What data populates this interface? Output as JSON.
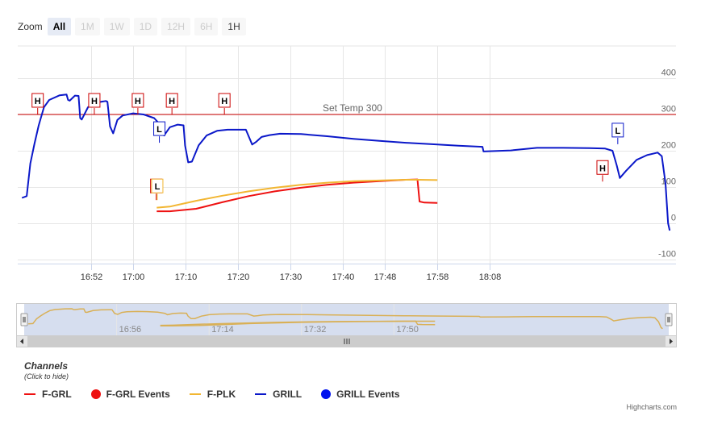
{
  "zoom": {
    "label": "Zoom",
    "buttons": [
      {
        "label": "All",
        "state": "active"
      },
      {
        "label": "1M",
        "state": "disabled"
      },
      {
        "label": "1W",
        "state": "disabled"
      },
      {
        "label": "1D",
        "state": "disabled"
      },
      {
        "label": "12H",
        "state": "disabled"
      },
      {
        "label": "6H",
        "state": "disabled"
      },
      {
        "label": "1H",
        "state": "enabled"
      }
    ]
  },
  "chart_data": {
    "type": "line",
    "x_ticks": [
      "16:52",
      "17:00",
      "17:10",
      "17:20",
      "17:30",
      "17:40",
      "17:48",
      "17:58",
      "18:08"
    ],
    "y_ticks": [
      400,
      300,
      200,
      100,
      0,
      -100
    ],
    "ylim": [
      -100,
      400
    ],
    "grid": true,
    "plot_line": {
      "value": 300,
      "label": "Set Temp 300",
      "color": "#cc0000"
    },
    "series": [
      {
        "name": "F-GRL",
        "color": "#ee1111",
        "points": [
          [
            -9,
            null
          ],
          [
            12.5,
            33
          ],
          [
            15,
            33
          ],
          [
            20,
            40
          ],
          [
            25,
            58
          ],
          [
            30,
            75
          ],
          [
            35,
            88
          ],
          [
            40,
            98
          ],
          [
            45,
            106
          ],
          [
            50,
            112
          ],
          [
            55,
            116
          ],
          [
            60,
            120
          ],
          [
            62.2,
            121
          ],
          [
            62.6,
            60
          ],
          [
            63.5,
            57
          ],
          [
            66,
            56
          ]
        ]
      },
      {
        "name": "F-PLK",
        "color": "#f2b632",
        "points": [
          [
            12.5,
            43
          ],
          [
            15,
            46
          ],
          [
            20,
            62
          ],
          [
            25,
            76
          ],
          [
            30,
            88
          ],
          [
            35,
            98
          ],
          [
            40,
            106
          ],
          [
            45,
            112
          ],
          [
            50,
            116
          ],
          [
            55,
            118
          ],
          [
            60,
            120
          ],
          [
            62.2,
            120
          ],
          [
            66,
            119
          ]
        ]
      },
      {
        "name": "GRILL",
        "color": "#0b18c9",
        "points": [
          [
            -13.2,
            70
          ],
          [
            -12.3,
            75
          ],
          [
            -11.6,
            165
          ],
          [
            -10.8,
            220
          ],
          [
            -10,
            270
          ],
          [
            -9,
            320
          ],
          [
            -8,
            340
          ],
          [
            -6,
            353
          ],
          [
            -4.7,
            355
          ],
          [
            -4.4,
            340
          ],
          [
            -4.1,
            338
          ],
          [
            -3.1,
            352
          ],
          [
            -2.4,
            351
          ],
          [
            -2.1,
            290
          ],
          [
            -1.8,
            286
          ],
          [
            -0.6,
            320
          ],
          [
            1,
            333
          ],
          [
            2.8,
            337
          ],
          [
            3.1,
            335
          ],
          [
            3.6,
            267
          ],
          [
            4.2,
            248
          ],
          [
            5,
            285
          ],
          [
            6,
            297
          ],
          [
            8,
            303
          ],
          [
            10,
            300
          ],
          [
            12,
            290
          ],
          [
            13.4,
            268
          ],
          [
            13.9,
            242
          ],
          [
            15,
            265
          ],
          [
            16.5,
            272
          ],
          [
            17.6,
            270
          ],
          [
            17.9,
            215
          ],
          [
            18.5,
            168
          ],
          [
            19.2,
            170
          ],
          [
            20.5,
            215
          ],
          [
            22,
            242
          ],
          [
            24,
            255
          ],
          [
            26,
            258
          ],
          [
            29.5,
            258
          ],
          [
            30.7,
            217
          ],
          [
            31.5,
            225
          ],
          [
            32.5,
            238
          ],
          [
            34,
            243
          ],
          [
            36,
            247
          ],
          [
            40,
            246
          ],
          [
            45,
            240
          ],
          [
            50,
            233
          ],
          [
            55,
            227
          ],
          [
            60,
            222
          ],
          [
            65,
            218
          ],
          [
            70,
            214
          ],
          [
            74.6,
            211
          ],
          [
            74.8,
            198
          ],
          [
            80,
            201
          ],
          [
            85,
            208
          ],
          [
            90,
            208
          ],
          [
            95,
            207
          ],
          [
            98,
            206
          ],
          [
            99.4,
            200
          ],
          [
            100.2,
            160
          ],
          [
            100.8,
            125
          ],
          [
            102,
            145
          ],
          [
            104,
            175
          ],
          [
            106,
            188
          ],
          [
            108,
            195
          ],
          [
            108.8,
            185
          ],
          [
            109.5,
            110
          ],
          [
            110,
            0
          ],
          [
            110.3,
            -20
          ]
        ]
      }
    ],
    "event_series": [
      {
        "name": "F-GRL Events",
        "color": "#ee1111"
      },
      {
        "name": "GRILL Events",
        "color": "#0011ee"
      }
    ],
    "event_flags": [
      {
        "label": "H",
        "x": -10.2,
        "y": 300,
        "color": "#cc0000"
      },
      {
        "label": "H",
        "x": 0.6,
        "y": 300,
        "color": "#cc0000"
      },
      {
        "label": "H",
        "x": 8.9,
        "y": 300,
        "color": "#cc0000"
      },
      {
        "label": "H",
        "x": 15.4,
        "y": 300,
        "color": "#cc0000"
      },
      {
        "label": "H",
        "x": 25.4,
        "y": 300,
        "color": "#cc0000"
      },
      {
        "label": "H",
        "x": 97.5,
        "y": 115,
        "color": "#cc0000"
      },
      {
        "label": "L",
        "x": 12.4,
        "y": 64,
        "color": "#cc0000"
      },
      {
        "label": "L",
        "x": 12.6,
        "y": 64,
        "color": "#f2b632"
      },
      {
        "label": "L",
        "x": 13.0,
        "y": 222,
        "color": "#0b18c9"
      },
      {
        "label": "L",
        "x": 100.4,
        "y": 218,
        "color": "#0b18c9"
      }
    ],
    "navigator_ticks": [
      "16:56",
      "17:14",
      "17:32",
      "17:50"
    ],
    "colors": {
      "grid": "#e6e6e6",
      "axis_label": "#666666",
      "navigator_mask": "#ccd6eb",
      "navigator_outline": "#cccccc",
      "scrollbar": "#cccccc"
    }
  },
  "legend": {
    "title": "Channels",
    "subtitle": "(Click to hide)",
    "items": [
      {
        "name": "F-GRL",
        "color": "#ee1111",
        "kind": "line"
      },
      {
        "name": "F-GRL Events",
        "color": "#ee1111",
        "kind": "dot"
      },
      {
        "name": "F-PLK",
        "color": "#f2b632",
        "kind": "line"
      },
      {
        "name": "GRILL",
        "color": "#0b18c9",
        "kind": "line"
      },
      {
        "name": "GRILL Events",
        "color": "#0011ee",
        "kind": "dot"
      }
    ]
  },
  "credits": "Highcharts.com"
}
